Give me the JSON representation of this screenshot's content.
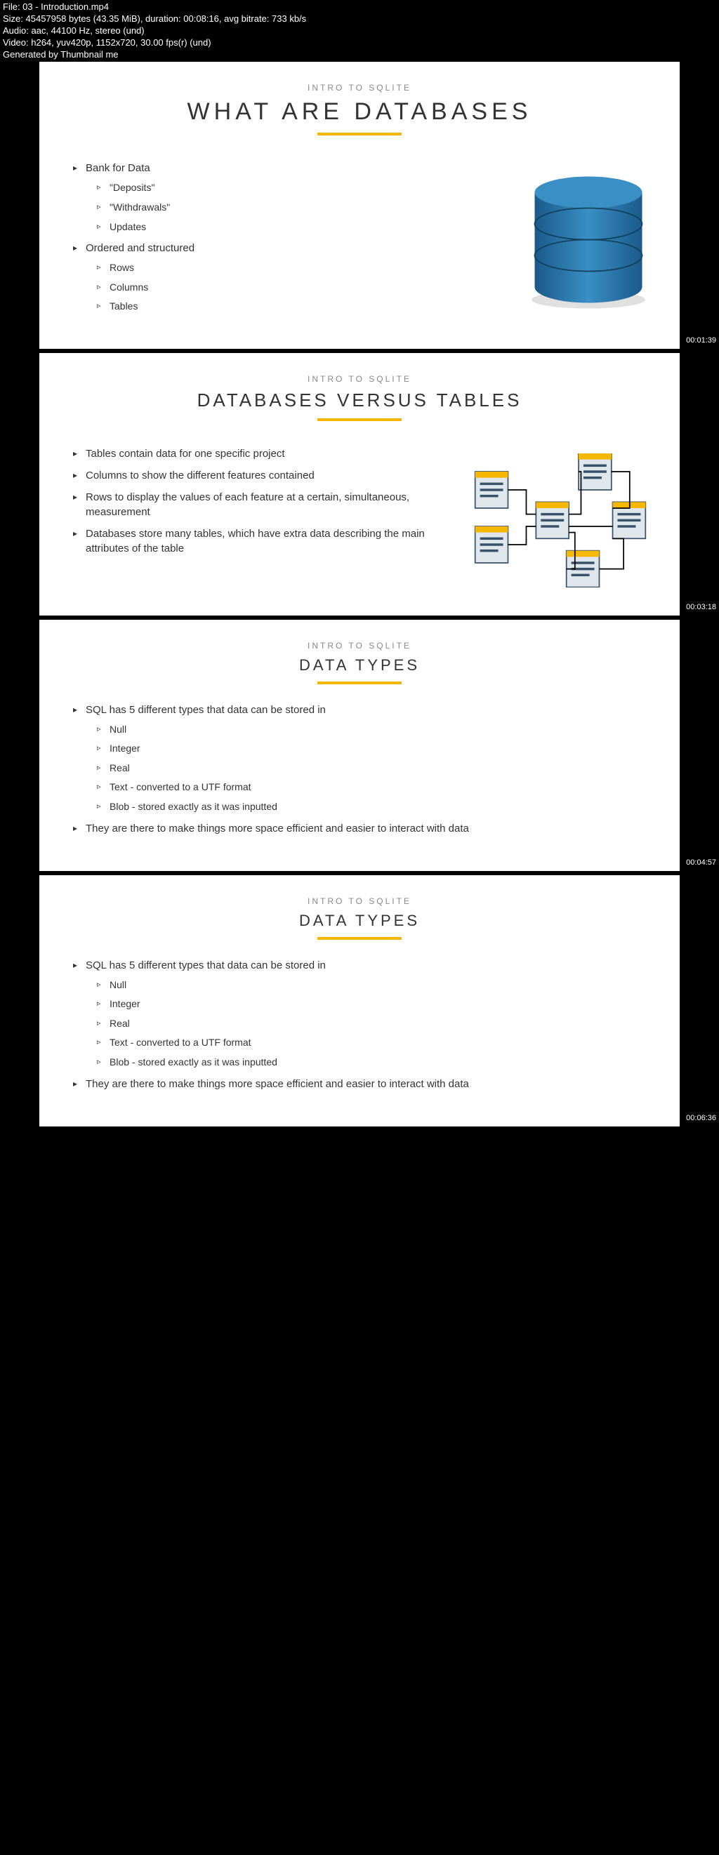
{
  "meta": {
    "file": "File: 03 - Introduction.mp4",
    "size": "Size: 45457958 bytes (43.35 MiB), duration: 00:08:16, avg bitrate: 733 kb/s",
    "audio": "Audio: aac, 44100 Hz, stereo (und)",
    "video": "Video: h264, yuv420p, 1152x720, 30.00 fps(r) (und)",
    "gen": "Generated by Thumbnail me"
  },
  "s1": {
    "eyebrow": "INTRO TO SQLITE",
    "title": "WHAT ARE DATABASES",
    "b1": "Bank for Data",
    "b1a": "\"Deposits\"",
    "b1b": "\"Withdrawals\"",
    "b1c": "Updates",
    "b2": "Ordered and structured",
    "b2a": "Rows",
    "b2b": "Columns",
    "b2c": "Tables",
    "ts": "00:01:39"
  },
  "s2": {
    "eyebrow": "INTRO TO SQLITE",
    "title": "DATABASES VERSUS TABLES",
    "b1": "Tables contain data for one specific project",
    "b2": "Columns to show the different features contained",
    "b3": "Rows to display the values of each feature at a certain, simultaneous, measurement",
    "b4": "Databases store many tables, which have extra data describing the main attributes of the table",
    "ts": "00:03:18"
  },
  "s3": {
    "eyebrow": "INTRO TO SQLITE",
    "title": "DATA TYPES",
    "b1": "SQL has 5 different types that data can be stored in",
    "b1a": "Null",
    "b1b": "Integer",
    "b1c": "Real",
    "b1d": "Text - converted to a UTF format",
    "b1e": "Blob - stored exactly as it was inputted",
    "b2": "They are there to make things more space efficient and easier to interact with data",
    "ts": "00:04:57"
  },
  "s4": {
    "eyebrow": "INTRO TO SQLITE",
    "title": "DATA TYPES",
    "b1": "SQL has 5 different types that data can be stored in",
    "b1a": "Null",
    "b1b": "Integer",
    "b1c": "Real",
    "b1d": "Text - converted to a UTF format",
    "b1e": "Blob - stored exactly as it was inputted",
    "b2": "They are there to make things more space efficient and easier to interact with data",
    "ts": "00:06:36"
  }
}
